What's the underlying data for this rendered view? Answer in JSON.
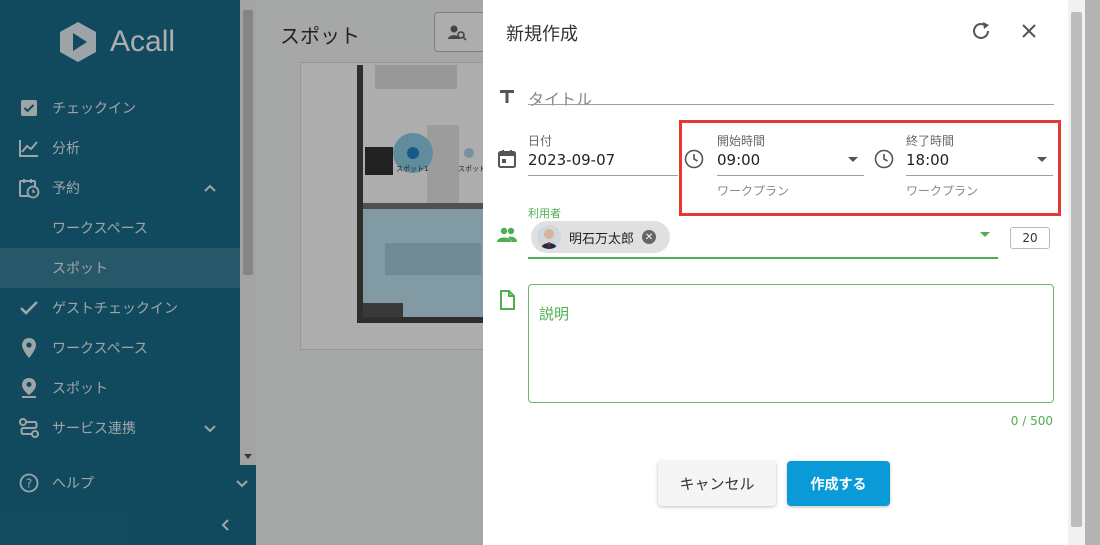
{
  "sidebar": {
    "logo_text": "Acall",
    "items": [
      {
        "label": "チェックイン",
        "icon": "checkbox-icon"
      },
      {
        "label": "分析",
        "icon": "chart-icon"
      },
      {
        "label": "予約",
        "icon": "calendar-clock-icon"
      },
      {
        "label": "ワークスペース",
        "icon": ""
      },
      {
        "label": "スポット",
        "icon": ""
      },
      {
        "label": "ゲストチェックイン",
        "icon": "check-icon"
      },
      {
        "label": "ワークスペース",
        "icon": "location-pin-icon"
      },
      {
        "label": "スポット",
        "icon": "person-pin-icon"
      },
      {
        "label": "サービス連携",
        "icon": "integration-icon"
      }
    ],
    "help_label": "ヘルプ"
  },
  "main": {
    "title": "スポット",
    "spot_labels": [
      "スポット1",
      "スポット"
    ]
  },
  "dialog": {
    "title": "新規作成",
    "title_placeholder": "タイトル",
    "date": {
      "label": "日付",
      "value": "2023-09-07"
    },
    "start_time": {
      "label": "開始時間",
      "value": "09:00",
      "hint": "ワークプラン"
    },
    "end_time": {
      "label": "終了時間",
      "value": "18:00",
      "hint": "ワークプラン"
    },
    "users": {
      "label": "利用者",
      "chip": "明石万太郎",
      "count": "20"
    },
    "description": {
      "label": "説明",
      "counter": "0 / 500"
    },
    "cancel_label": "キャンセル",
    "create_label": "作成する"
  },
  "colors": {
    "sidebar": "#1a6e8c",
    "accent": "#0a9ad7",
    "green": "#4caf50",
    "highlight": "#e53935"
  }
}
